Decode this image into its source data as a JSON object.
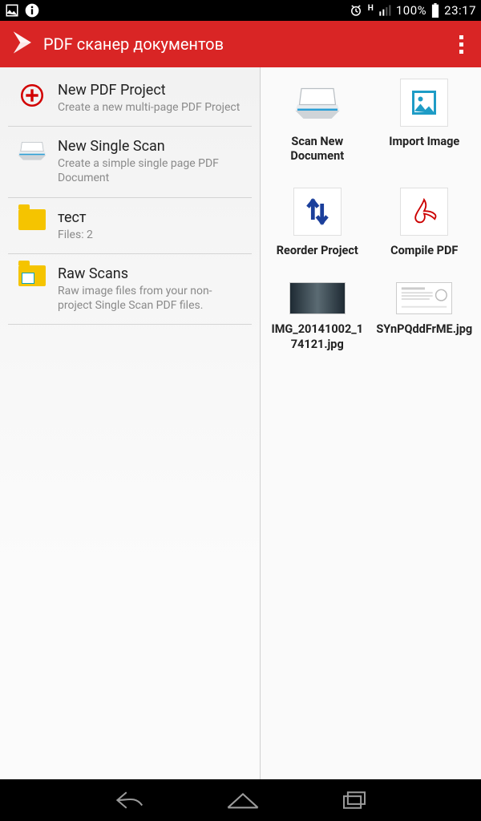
{
  "status": {
    "battery_pct": "100%",
    "time": "23:17",
    "net_indicator": "H"
  },
  "action_bar": {
    "title": "PDF сканер документов"
  },
  "left_items": [
    {
      "title": "New PDF Project",
      "sub": "Create a new multi-page PDF Project"
    },
    {
      "title": "New Single Scan",
      "sub": "Create a simple single page PDF Document"
    },
    {
      "title": "тест",
      "sub": "Files: 2"
    },
    {
      "title": "Raw Scans",
      "sub": "Raw image files from your non-project Single Scan PDF files."
    }
  ],
  "right_actions": [
    {
      "label": "Scan New Document"
    },
    {
      "label": "Import Image"
    },
    {
      "label": "Reorder Project"
    },
    {
      "label": "Compile PDF"
    }
  ],
  "right_files": [
    {
      "label": "IMG_20141002_174121.jpg"
    },
    {
      "label": "SYnPQddFrME.jpg"
    }
  ]
}
